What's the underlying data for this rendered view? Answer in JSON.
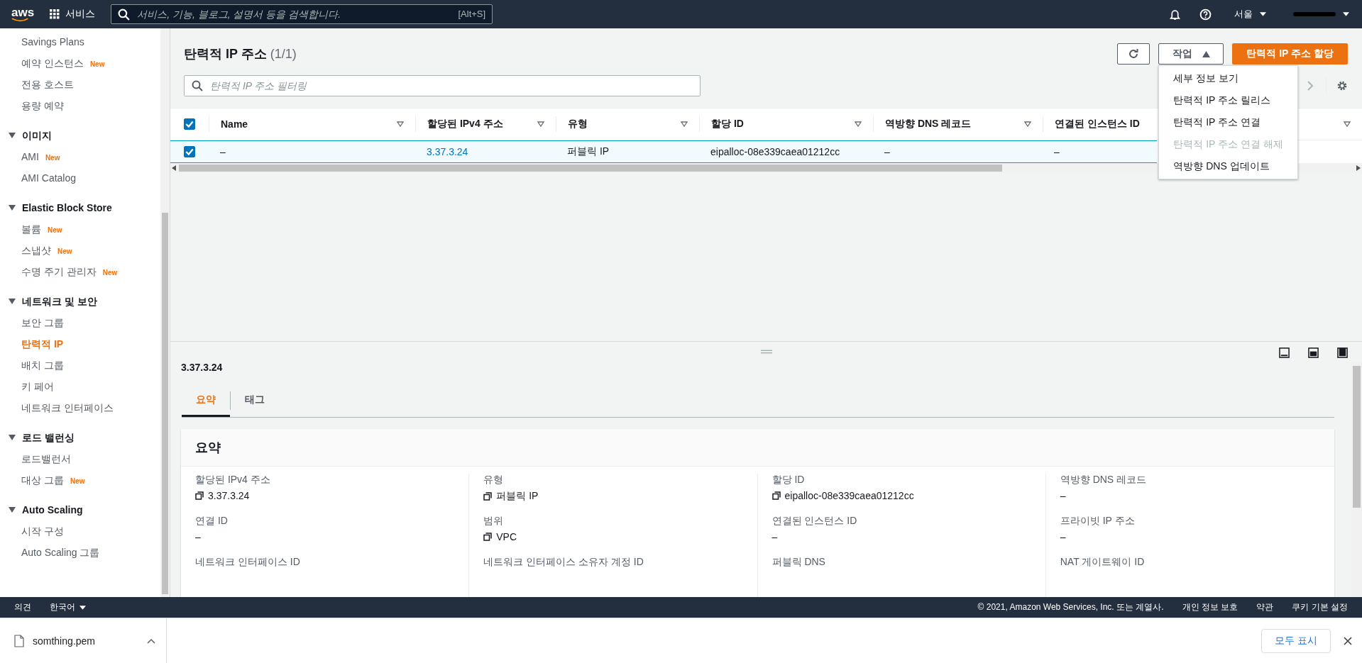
{
  "topnav": {
    "logo": "aws",
    "services": "서비스",
    "search": {
      "placeholder": "서비스, 기능, 블로그, 설명서 등을 검색합니다."
    },
    "shortcut": "[Alt+S]",
    "region": "서울"
  },
  "sidebar": {
    "items": [
      {
        "label": "Savings Plans",
        "selected": false
      },
      {
        "label": "예약 인스턴스",
        "badge": "New",
        "selected": false
      },
      {
        "label": "전용 호스트",
        "selected": false
      },
      {
        "label": "용량 예약",
        "selected": false
      }
    ],
    "sections": [
      {
        "title": "이미지",
        "expanded": true,
        "items": [
          {
            "label": "AMI",
            "badge": "New",
            "selected": false
          },
          {
            "label": "AMI Catalog",
            "selected": false
          }
        ]
      },
      {
        "title": "Elastic Block Store",
        "expanded": true,
        "items": [
          {
            "label": "볼륨",
            "badge": "New",
            "selected": false
          },
          {
            "label": "스냅샷",
            "badge": "New",
            "selected": false
          },
          {
            "label": "수명 주기 관리자",
            "badge": "New",
            "selected": false
          }
        ]
      },
      {
        "title": "네트워크 및 보안",
        "expanded": true,
        "items": [
          {
            "label": "보안 그룹",
            "selected": false
          },
          {
            "label": "탄력적 IP",
            "selected": true
          },
          {
            "label": "배치 그룹",
            "selected": false
          },
          {
            "label": "키 페어",
            "selected": false
          },
          {
            "label": "네트워크 인터페이스",
            "selected": false
          }
        ]
      },
      {
        "title": "로드 밸런싱",
        "expanded": true,
        "items": [
          {
            "label": "로드밸런서",
            "selected": false
          },
          {
            "label": "대상 그룹",
            "badge": "New",
            "selected": false
          }
        ]
      },
      {
        "title": "Auto Scaling",
        "expanded": true,
        "items": [
          {
            "label": "시작 구성",
            "selected": false
          },
          {
            "label": "Auto Scaling 그룹",
            "selected": false
          }
        ]
      }
    ]
  },
  "header": {
    "title": "탄력적 IP 주소",
    "count": "(1/1)",
    "actions": {
      "label": "작업",
      "expanded": true
    },
    "primary": "탄력적 IP 주소 할당",
    "filter": {
      "placeholder": "탄력적 IP 주소 필터링"
    }
  },
  "actions_menu": [
    {
      "label": "세부 정보 보기",
      "disabled": false
    },
    {
      "label": "탄력적 IP 주소 릴리스",
      "disabled": false
    },
    {
      "label": "탄력적 IP 주소 연결",
      "disabled": false
    },
    {
      "label": "탄력적 IP 주소 연결 해제",
      "disabled": true
    },
    {
      "label": "역방향 DNS 업데이트",
      "disabled": false
    }
  ],
  "table": {
    "select_all": {
      "checked": true
    },
    "columns": [
      "Name",
      "할당된 IPv4 주소",
      "유형",
      "할당 ID",
      "역방향 DNS 레코드",
      "연결된 인스턴스 ID"
    ],
    "rows": [
      {
        "checked": true,
        "selected": true,
        "cells": [
          {
            "text": "–",
            "kind": "text"
          },
          {
            "text": "3.37.3.24",
            "kind": "link"
          },
          {
            "text": "퍼블릭 IP",
            "kind": "text"
          },
          {
            "text": "eipalloc-08e339caea01212cc",
            "kind": "text"
          },
          {
            "text": "–",
            "kind": "text"
          },
          {
            "text": "–",
            "kind": "text"
          }
        ]
      }
    ]
  },
  "details": {
    "title": "3.37.3.24",
    "tabs": [
      {
        "label": "요약",
        "selected": true
      },
      {
        "label": "태그",
        "selected": false
      }
    ],
    "card_title": "요약",
    "fields": [
      {
        "label": "할당된 IPv4 주소",
        "value": "3.37.3.24",
        "copy": true
      },
      {
        "label": "유형",
        "value": "퍼블릭 IP",
        "copy": true
      },
      {
        "label": "할당 ID",
        "value": "eipalloc-08e339caea01212cc",
        "copy": true
      },
      {
        "label": "역방향 DNS 레코드",
        "value": "–"
      },
      {
        "label": "연결 ID",
        "value": "–"
      },
      {
        "label": "범위",
        "value": "VPC",
        "copy": true
      },
      {
        "label": "연결된 인스턴스 ID",
        "value": "–"
      },
      {
        "label": "프라이빗 IP 주소",
        "value": "–"
      },
      {
        "label": "네트워크 인터페이스 ID"
      },
      {
        "label": "네트워크 인터페이스 소유자 계정 ID"
      },
      {
        "label": "퍼블릭 DNS"
      },
      {
        "label": "NAT 게이트웨이 ID"
      }
    ]
  },
  "footer": {
    "feedback": "의견",
    "language": "한국어",
    "copyright": "© 2021, Amazon Web Services, Inc. 또는 계열사.",
    "links": [
      "개인 정보 보호",
      "약관",
      "쿠키 기본 설정"
    ]
  },
  "downloads": {
    "file": "somthing.pem",
    "show_all": "모두 표시"
  }
}
